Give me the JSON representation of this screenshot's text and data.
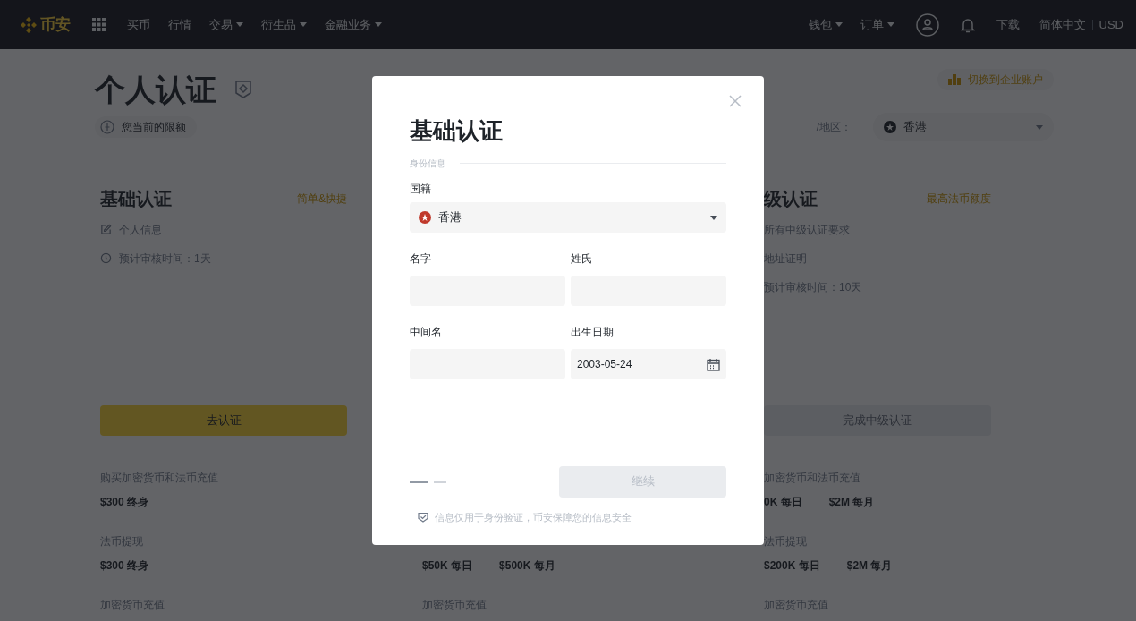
{
  "navbar": {
    "logo": "币安",
    "left_items": [
      {
        "label": "买币",
        "dropdown": false
      },
      {
        "label": "行情",
        "dropdown": false
      },
      {
        "label": "交易",
        "dropdown": true
      },
      {
        "label": "衍生品",
        "dropdown": true
      },
      {
        "label": "金融业务",
        "dropdown": true
      }
    ],
    "right_items": [
      {
        "label": "钱包",
        "dropdown": true
      },
      {
        "label": "订单",
        "dropdown": true
      }
    ],
    "download": "下载",
    "language": "简体中文",
    "currency": "USD"
  },
  "page": {
    "title": "个人认证",
    "limit_badge": "您当前的限额",
    "switch_account": "切换到企业账户",
    "region_label": "/地区：",
    "region_value": "香港",
    "columns": [
      {
        "title": "基础认证",
        "tag": "简单&快捷",
        "features": [
          {
            "kind": "edit",
            "text": "个人信息"
          },
          {
            "kind": "clock",
            "text": "预计审核时间：1天"
          }
        ],
        "button": {
          "label": "去认证",
          "disabled": false
        },
        "limits": [
          {
            "label": "购买加密货币和法币充值",
            "values": [
              "$300 终身"
            ]
          },
          {
            "label": "法币提现",
            "values": [
              "$300 终身"
            ]
          },
          {
            "label": "加密货币充值"
          }
        ]
      },
      {
        "limits": [
          {
            "values": [
              "$50K 每日",
              "$500K 每月"
            ]
          },
          {
            "label": "加密货币充值"
          }
        ]
      },
      {
        "title": "级认证",
        "tag": "最高法币额度",
        "features": [
          {
            "kind": "none",
            "text": "所有中级认证要求"
          },
          {
            "kind": "none",
            "text": "地址证明"
          },
          {
            "kind": "none",
            "text": "预计审核时间：10天"
          }
        ],
        "button": {
          "label": "完成中级认证",
          "disabled": true
        },
        "limits": [
          {
            "label": "加密货币和法币充值",
            "values": [
              "0K 每日",
              "$2M 每月"
            ]
          },
          {
            "label": "法币提现",
            "values": [
              "$200K 每日",
              "$2M 每月"
            ]
          },
          {
            "label": "加密货币充值"
          }
        ]
      }
    ]
  },
  "dialog": {
    "title": "基础认证",
    "section": "身份信息",
    "nationality": {
      "label": "国籍",
      "value": "香港"
    },
    "fields": [
      {
        "label": "名字",
        "kind": "text"
      },
      {
        "label": "姓氏",
        "kind": "text"
      },
      {
        "label": "中间名",
        "kind": "text"
      },
      {
        "label": "出生日期",
        "kind": "date",
        "value": "2003-05-24"
      }
    ],
    "steps": [
      {
        "selected": true
      },
      {
        "selected": false
      }
    ],
    "continue_button": {
      "label": "继续",
      "disabled": true
    },
    "notice": "信息仅用于身份验证，币安保障您的信息安全"
  }
}
